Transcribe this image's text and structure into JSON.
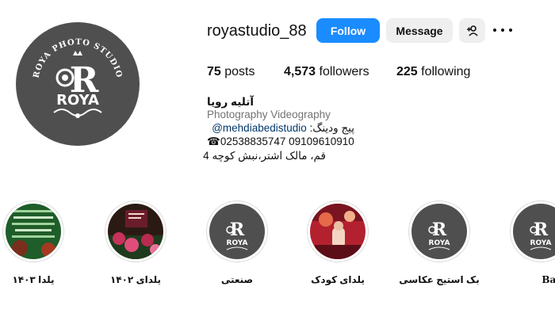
{
  "profile": {
    "username": "royastudio_88",
    "follow_label": "Follow",
    "message_label": "Message",
    "avatar_text": "ROYA",
    "avatar_ring_text": "ROYA PHOTO STUDIO"
  },
  "stats": {
    "posts_count": "75",
    "posts_label": "posts",
    "followers_count": "4,573",
    "followers_label": "followers",
    "following_count": "225",
    "following_label": "following"
  },
  "bio": {
    "name": "آتلیه رویا",
    "category": "Photography Videography",
    "link_prefix": "پیج ودینگ: ",
    "link_handle": "@mehdiabedistudio",
    "phone": "☎02538835747 09109610910",
    "address": "قم، مالک اشتر،نبش کوچه 4"
  },
  "highlights": [
    {
      "label": "یلدا ۱۴۰۳",
      "style": "green-text"
    },
    {
      "label": "یلدای ۱۴۰۲",
      "style": "flowers"
    },
    {
      "label": "صنعتی",
      "style": "logo"
    },
    {
      "label": "یلدای کودک",
      "style": "red"
    },
    {
      "label": "بک استیج عکاسی",
      "style": "logo"
    },
    {
      "label": "Baby",
      "style": "logo"
    }
  ],
  "icons": {
    "more": "more-options-icon",
    "suggest": "add-person-icon"
  },
  "colors": {
    "follow_button": "#1a8cff",
    "secondary_button": "#efefef",
    "link": "#00376b",
    "logo_bg": "#4f4f4f"
  }
}
